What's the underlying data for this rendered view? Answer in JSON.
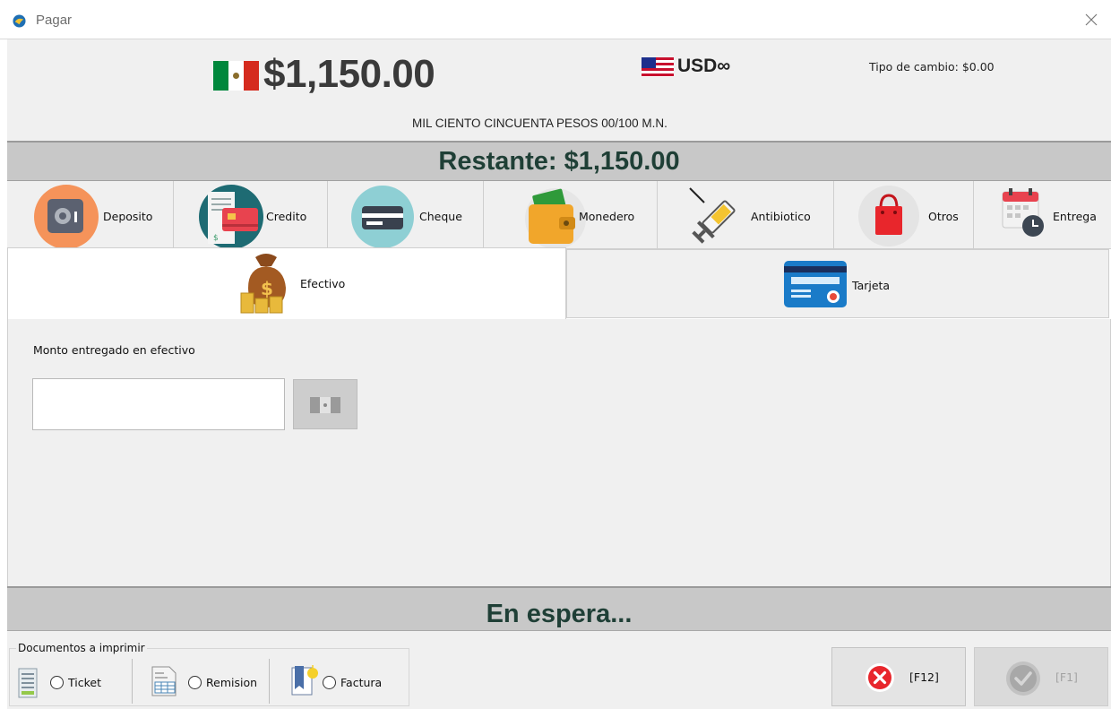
{
  "window": {
    "title": "Pagar",
    "close_icon": "close-icon"
  },
  "header": {
    "amount": "$1,150.00",
    "currency_label": "USD∞",
    "exchange_rate": "Tipo de cambio: $0.00",
    "amount_words": "MIL CIENTO CINCUENTA PESOS  00/100 M.N."
  },
  "restante": "Restante: $1,150.00",
  "methods": [
    {
      "label": "Deposito",
      "icon": "safe-icon"
    },
    {
      "label": "Credito",
      "icon": "credit-card-receipt-icon"
    },
    {
      "label": "Cheque",
      "icon": "cheque-icon"
    },
    {
      "label": "Monedero",
      "icon": "wallet-icon"
    },
    {
      "label": "Antibiotico",
      "icon": "syringe-icon"
    },
    {
      "label": "Otros",
      "icon": "shopping-bag-icon"
    },
    {
      "label": "Entrega",
      "icon": "calendar-clock-icon"
    }
  ],
  "tabs": [
    {
      "label": "Efectivo",
      "icon": "money-bag-icon",
      "active": true
    },
    {
      "label": "Tarjeta",
      "icon": "bank-card-icon",
      "active": false
    }
  ],
  "cash": {
    "label": "Monto entregado en efectivo",
    "value": "",
    "placeholder": ""
  },
  "status": "En espera...",
  "documents": {
    "title": "Documentos a imprimir",
    "items": [
      {
        "label": "Ticket",
        "icon": "ticket-icon",
        "checked": false
      },
      {
        "label": "Remision",
        "icon": "remision-icon",
        "checked": false
      },
      {
        "label": "Factura",
        "icon": "factura-icon",
        "checked": false
      }
    ]
  },
  "actions": {
    "cancel_label": "[F12]",
    "accept_label": "[F1]"
  },
  "colors": {
    "status_text": "#1f3f36",
    "status_bar": "#c8c8c8",
    "panel": "#f0f0f0",
    "cancel_red": "#e8262c"
  }
}
